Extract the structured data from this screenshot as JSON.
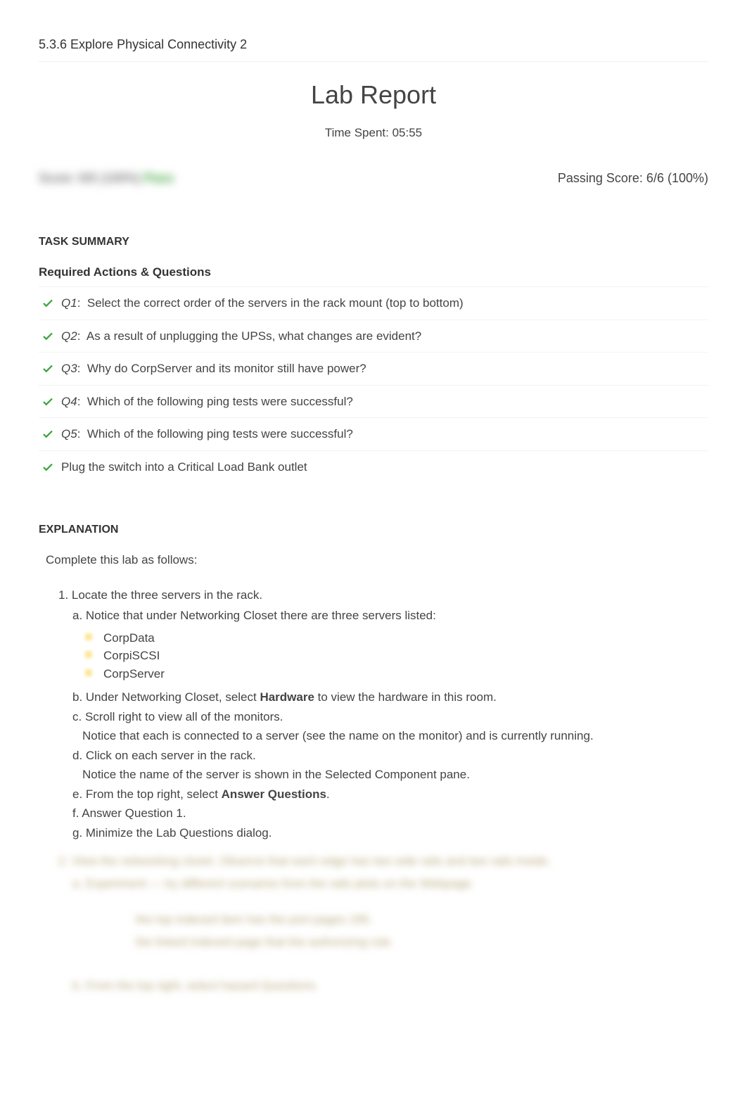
{
  "header": {
    "lab_number": "5.3.6 Explore Physical Connectivity 2",
    "report_title": "Lab Report",
    "time_spent": "Time Spent: 05:55"
  },
  "score": {
    "blurred_text": "Score: 6/6 (100%) ",
    "blurred_pass": "Pass",
    "passing": "Passing Score: 6/6 (100%)"
  },
  "task_summary": {
    "heading": "TASK SUMMARY",
    "subheading": "Required Actions & Questions",
    "items": [
      {
        "q": "Q1",
        "text": "Select the correct order of the servers in the rack mount (top to bottom)"
      },
      {
        "q": "Q2",
        "text": "As a result of unplugging the UPSs, what changes are evident?"
      },
      {
        "q": "Q3",
        "text": "Why do CorpServer and its monitor still have power?"
      },
      {
        "q": "Q4",
        "text": "Which of the following ping tests were successful?"
      },
      {
        "q": "Q5",
        "text": "Which of the following ping tests were successful?"
      },
      {
        "q": "",
        "text": "Plug the switch into a Critical Load Bank outlet"
      }
    ]
  },
  "explanation": {
    "heading": "EXPLANATION",
    "intro": "Complete this lab as follows:",
    "step1_title": "1. Locate the three servers in the rack.",
    "step1": {
      "a": "a. Notice that under Networking Closet there are three servers listed:",
      "servers": [
        "CorpData",
        "CorpiSCSI",
        "CorpServer"
      ],
      "b_pre": "b. Under Networking Closet, select ",
      "b_bold": "Hardware",
      "b_post": " to view the hardware in this room.",
      "c": "c. Scroll right to view all of the monitors.",
      "c_note": "Notice that each is connected to a server (see the name on the monitor) and is currently running.",
      "d": "d. Click on each server in the rack.",
      "d_note": "Notice the name of the server is shown in the Selected Component pane.",
      "e_pre": "e. From the top right, select ",
      "e_bold": "Answer Questions",
      "e_post": ".",
      "f": "f. Answer Question 1.",
      "g": "g. Minimize the Lab Questions dialog."
    },
    "blurred_lines": [
      "2. View the networking closet. Observe that each edge has two side rails and two rails inside.",
      "a. Experiment — try different scenarios from the rails plots on the Webpage.",
      "the top indexed item has the port pages 195.",
      "the linked indexed page that the authorizing rule.",
      "b. From the top right, select          hazard Questions."
    ]
  }
}
